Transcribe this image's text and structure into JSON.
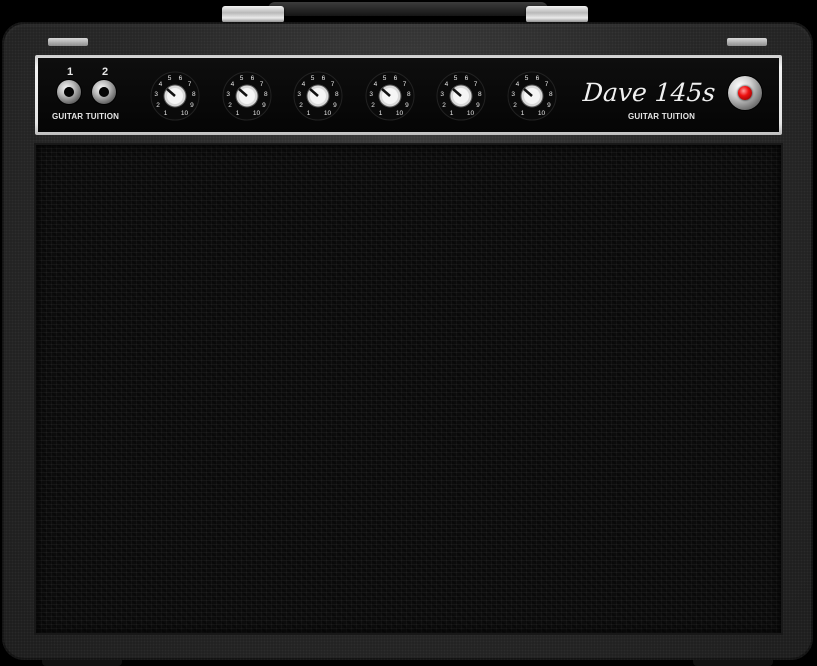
{
  "amp": {
    "model_name": "Dave 145s",
    "left_caption": "GUITAR TUITION",
    "right_caption": "GUITAR TUITION"
  },
  "inputs": [
    {
      "label": "1"
    },
    {
      "label": "2"
    }
  ],
  "knobs": [
    {
      "id": "knob-1"
    },
    {
      "id": "knob-2"
    },
    {
      "id": "knob-3"
    },
    {
      "id": "knob-4"
    },
    {
      "id": "knob-5"
    },
    {
      "id": "knob-6"
    }
  ],
  "knob_scale": [
    "1",
    "2",
    "3",
    "4",
    "5",
    "6",
    "7",
    "8",
    "9",
    "10"
  ],
  "colors": {
    "tolex": "#262626",
    "panel_trim": "#e6e6e6",
    "panel_face": "#0a0a0a",
    "grille": "#0c0c0c",
    "jewel_light": "#dd1111"
  }
}
